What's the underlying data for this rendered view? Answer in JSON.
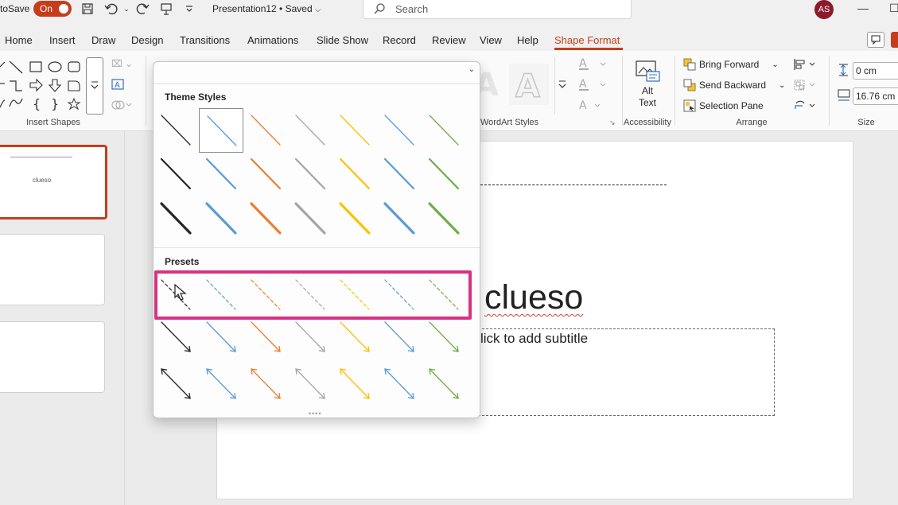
{
  "titlebar": {
    "autosave_label": "toSave",
    "autosave_state": "On",
    "doc_title": "Presentation12 • Saved",
    "search_placeholder": "Search",
    "avatar_initials": "AS"
  },
  "tabs": [
    "Home",
    "Insert",
    "Draw",
    "Design",
    "Transitions",
    "Animations",
    "Slide Show",
    "Record",
    "Review",
    "View",
    "Help",
    "Shape Format"
  ],
  "active_tab": "Shape Format",
  "ribbon": {
    "groups": {
      "insert_shapes": "Insert Shapes",
      "wordart_styles": "WordArt Styles",
      "accessibility": "Accessibility",
      "arrange": "Arrange",
      "size": "Size"
    },
    "alt_text_line1": "Alt",
    "alt_text_line2": "Text",
    "bring_forward": "Bring Forward",
    "send_backward": "Send Backward",
    "selection_pane": "Selection Pane",
    "height_value": "0 cm",
    "width_value": "16.76 cm"
  },
  "thumbnails": [
    {
      "text": "clueso",
      "selected": true
    },
    {
      "text": "",
      "selected": false
    },
    {
      "text": "",
      "selected": false
    }
  ],
  "slide": {
    "title": "clueso",
    "subtitle_placeholder": "lick to add subtitle"
  },
  "gallery": {
    "theme_styles_label": "Theme Styles",
    "presets_label": "Presets",
    "colors": [
      "#262626",
      "#5b9bd5",
      "#ed7d31",
      "#a5a5a5",
      "#ffc000",
      "#5b9bd5",
      "#70ad47"
    ],
    "selected_theme_cell": 1
  },
  "colors": {
    "accent": "#c43e1c",
    "highlight_box": "#d63384"
  }
}
